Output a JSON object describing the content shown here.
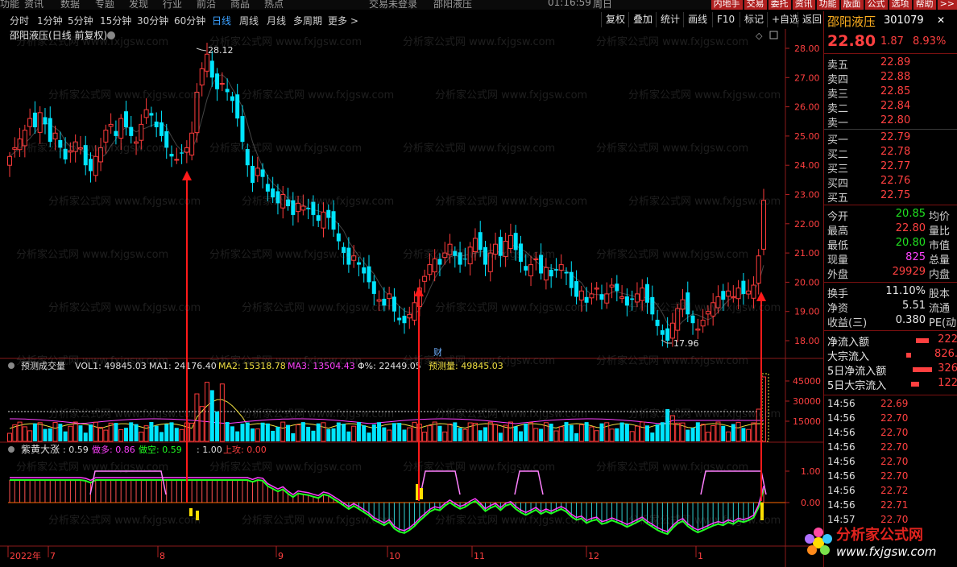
{
  "topmenu": {
    "items": [
      "功能",
      "资讯",
      "数据",
      "专题",
      "发现",
      "行业",
      "前沿",
      "商品",
      "热点"
    ],
    "login_status": "交易未登录",
    "stock_name": "邵阳液压",
    "time": "01:16:59",
    "weekday": "周日",
    "buttons": [
      "内地手",
      "交易",
      "委托",
      "资讯",
      "功能",
      "版面",
      "公式",
      "选项",
      "帮助",
      ">>"
    ]
  },
  "periods": {
    "items": [
      "分时",
      "1分钟",
      "5分钟",
      "15分钟",
      "30分钟",
      "60分钟",
      "日线",
      "周线",
      "月线",
      "多周期",
      "更多 >"
    ],
    "active_index": 6
  },
  "toolbar": {
    "buttons": [
      "复权",
      "叠加",
      "统计",
      "画线",
      "F10",
      "标记",
      "+自选",
      "返回"
    ]
  },
  "main_chart": {
    "title": "邵阳液压(日线 前复权)",
    "price_ticks": [
      "28.00",
      "27.00",
      "26.00",
      "25.00",
      "24.00",
      "23.00",
      "22.00",
      "21.00",
      "20.00",
      "19.00",
      "18.00"
    ],
    "high_label": "28.12",
    "low_label": "17.96",
    "colors": {
      "up": "#ff3b3b",
      "down": "#00e5ff",
      "arrow": "#ff1a1a",
      "ma_white": "#f0f0f0",
      "ma_yellow": "#f0e040",
      "ma_magenta": "#ff40ff",
      "ma_green": "#20ff20"
    }
  },
  "volume_panel": {
    "name": "预测成交量",
    "vol1_label": "VOL1: 49845.03",
    "ma1_label": "MA1: 24176.40",
    "ma2_label": "MA2: 15318.78",
    "ma3_label": "MA3: 13504.43",
    "pct_label": "Φ%: 22449.05",
    "pred_label": "预测量: 49845.03",
    "cai_label": "财",
    "ticks": [
      "45000",
      "30000",
      "15000"
    ]
  },
  "indicator_panel": {
    "name": "紫黄大涨",
    "value_label": ": 0.59",
    "long_label": "做多: 0.86",
    "short_label": "做空: 0.59",
    "v1_label": ": 1.00",
    "up_label": "上攻: 0.00",
    "ticks": [
      "1.00",
      "0.00"
    ]
  },
  "date_axis": [
    "2022年",
    "7",
    "8",
    "9",
    "10",
    "11",
    "12",
    "1"
  ],
  "quote": {
    "name": "邵阳液压",
    "code": "301079",
    "price": "22.80",
    "change": "1.87",
    "change_pct": "8.93%",
    "asks": [
      {
        "label": "卖五",
        "price": "22.89"
      },
      {
        "label": "卖四",
        "price": "22.88"
      },
      {
        "label": "卖三",
        "price": "22.85"
      },
      {
        "label": "卖二",
        "price": "22.84"
      },
      {
        "label": "卖一",
        "price": "22.80"
      }
    ],
    "bids": [
      {
        "label": "买一",
        "price": "22.79"
      },
      {
        "label": "买二",
        "price": "22.78"
      },
      {
        "label": "买三",
        "price": "22.77"
      },
      {
        "label": "买四",
        "price": "22.76"
      },
      {
        "label": "买五",
        "price": "22.75"
      }
    ],
    "stats": [
      {
        "l1": "今开",
        "v1": "20.85",
        "c1": "green",
        "l2": "均价"
      },
      {
        "l1": "最高",
        "v1": "22.80",
        "c1": "red",
        "l2": "量比"
      },
      {
        "l1": "最低",
        "v1": "20.80",
        "c1": "green",
        "l2": "市值"
      },
      {
        "l1": "现量",
        "v1": "825",
        "c1": "mag",
        "l2": "总量"
      },
      {
        "l1": "外盘",
        "v1": "29929",
        "c1": "red",
        "l2": "内盘"
      }
    ],
    "stats2": [
      {
        "l1": "换手",
        "v1": "11.10%",
        "l2": "股本"
      },
      {
        "l1": "净资",
        "v1": "5.51",
        "l2": "流通"
      },
      {
        "l1": "收益(三)",
        "v1": "0.380",
        "l2": "PE(动)"
      }
    ],
    "flows": [
      {
        "label": "净流入额",
        "value": "222"
      },
      {
        "label": "大宗流入",
        "value": "826."
      },
      {
        "label": "5日净流入额",
        "value": "326"
      },
      {
        "label": "5日大宗流入",
        "value": "122"
      }
    ],
    "ticks": [
      {
        "time": "14:56",
        "price": "22.69"
      },
      {
        "time": "14:56",
        "price": "22.70"
      },
      {
        "time": "14:56",
        "price": "22.70"
      },
      {
        "time": "14:56",
        "price": "22.70"
      },
      {
        "time": "14:56",
        "price": "22.70"
      },
      {
        "time": "14:56",
        "price": "22.70"
      },
      {
        "time": "14:56",
        "price": "22.72"
      },
      {
        "time": "14:56",
        "price": "22.71"
      },
      {
        "time": "14:57",
        "price": "22.70"
      }
    ]
  },
  "watermark": {
    "text": "分析家公式网 www.fxjgsw.com",
    "logo_title": "分析家公式网",
    "logo_url": "www.fxjgsw.com"
  }
}
